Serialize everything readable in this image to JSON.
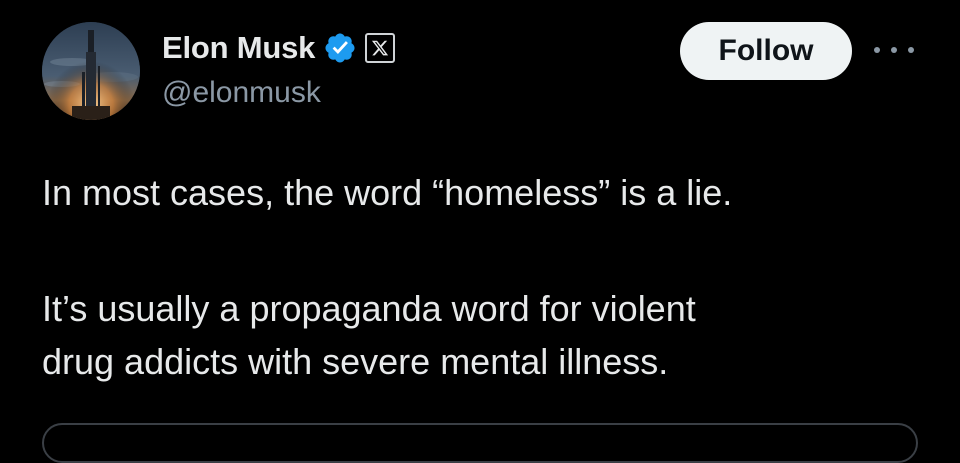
{
  "author": {
    "display_name": "Elon Musk",
    "handle": "@elonmusk",
    "verified_badge": "verified-checkmark-icon",
    "affiliation_badge": "x-logo-icon"
  },
  "actions": {
    "follow_label": "Follow",
    "more_icon": "more-horizontal-icon"
  },
  "tweet": {
    "paragraphs": [
      {
        "lines": [
          "In most cases, the word “homeless” is a lie."
        ]
      },
      {
        "lines": [
          "It’s usually a propaganda word for violent",
          "drug addicts with severe mental illness."
        ]
      }
    ]
  },
  "colors": {
    "background": "#000000",
    "text_primary": "#e7e9ea",
    "text_secondary": "#8b98a5",
    "verified_blue": "#1d9bf0",
    "follow_button_bg": "#eff3f4"
  }
}
